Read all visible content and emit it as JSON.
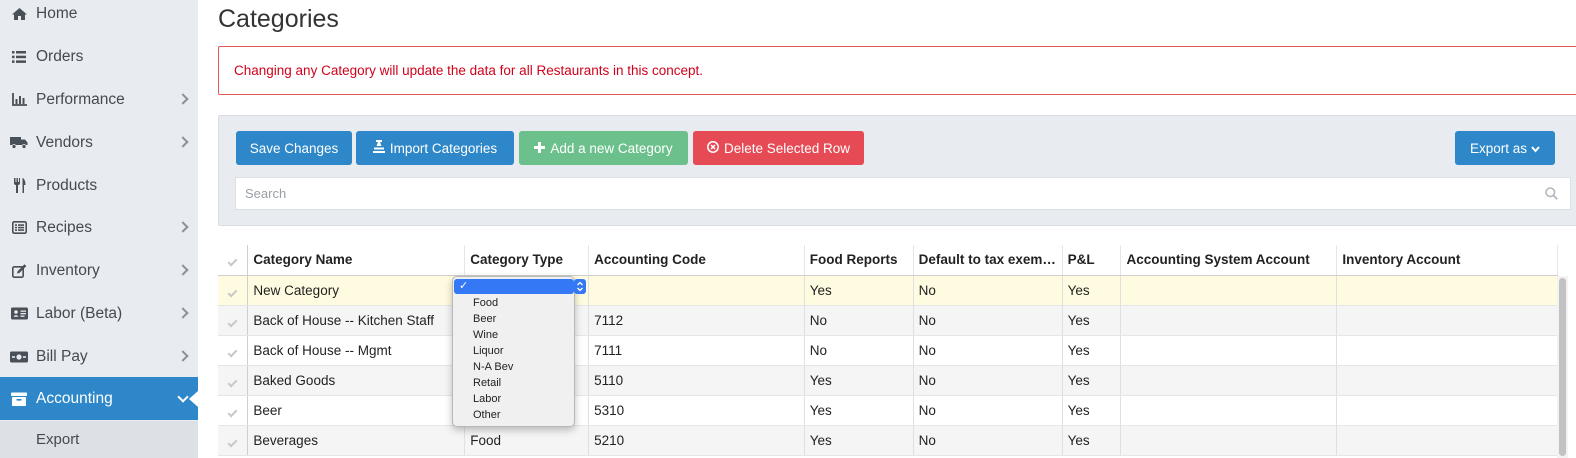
{
  "sidebar": {
    "items": [
      {
        "label": "Home",
        "icon": "home-icon",
        "has_chevron": false
      },
      {
        "label": "Orders",
        "icon": "list-icon",
        "has_chevron": false
      },
      {
        "label": "Performance",
        "icon": "bar-chart-icon",
        "has_chevron": true
      },
      {
        "label": "Vendors",
        "icon": "truck-icon",
        "has_chevron": true
      },
      {
        "label": "Products",
        "icon": "utensils-icon",
        "has_chevron": false
      },
      {
        "label": "Recipes",
        "icon": "list-alt-icon",
        "has_chevron": true
      },
      {
        "label": "Inventory",
        "icon": "edit-icon",
        "has_chevron": true
      },
      {
        "label": "Labor (Beta)",
        "icon": "id-card-icon",
        "has_chevron": true
      },
      {
        "label": "Bill Pay",
        "icon": "money-icon",
        "has_chevron": true
      },
      {
        "label": "Accounting",
        "icon": "archive-icon",
        "has_chevron": true,
        "active": true
      }
    ],
    "sub_item": "Export"
  },
  "page": {
    "title": "Categories",
    "alert": "Changing any Category will update the data for all Restaurants in this concept."
  },
  "toolbar": {
    "save_label": "Save Changes",
    "import_label": "Import Categories",
    "add_label": "Add a new Category",
    "delete_label": "Delete Selected Row",
    "export_label": "Export as",
    "search_placeholder": "Search"
  },
  "table": {
    "columns": [
      "Category Name",
      "Category Type",
      "Accounting Code",
      "Food Reports",
      "Default to tax exem…",
      "P&L",
      "Accounting System Account",
      "Inventory Account"
    ],
    "rows": [
      {
        "name": "New Category",
        "type": "",
        "code": "",
        "food_reports": "Yes",
        "tax_exempt": "No",
        "pl": "Yes",
        "acct_system": "",
        "inventory": ""
      },
      {
        "name": "Back of House -- Kitchen Staff",
        "type": "",
        "code": "7112",
        "food_reports": "No",
        "tax_exempt": "No",
        "pl": "Yes",
        "acct_system": "",
        "inventory": ""
      },
      {
        "name": "Back of House -- Mgmt",
        "type": "",
        "code": "7111",
        "food_reports": "No",
        "tax_exempt": "No",
        "pl": "Yes",
        "acct_system": "",
        "inventory": ""
      },
      {
        "name": "Baked Goods",
        "type": "",
        "code": "5110",
        "food_reports": "Yes",
        "tax_exempt": "No",
        "pl": "Yes",
        "acct_system": "",
        "inventory": ""
      },
      {
        "name": "Beer",
        "type": "",
        "code": "5310",
        "food_reports": "Yes",
        "tax_exempt": "No",
        "pl": "Yes",
        "acct_system": "",
        "inventory": ""
      },
      {
        "name": "Beverages",
        "type": "Food",
        "code": "5210",
        "food_reports": "Yes",
        "tax_exempt": "No",
        "pl": "Yes",
        "acct_system": "",
        "inventory": ""
      }
    ]
  },
  "dropdown": {
    "selected_mark": "✓",
    "options": [
      "Food",
      "Beer",
      "Wine",
      "Liquor",
      "N-A Bev",
      "Retail",
      "Labor",
      "Other"
    ]
  },
  "colors": {
    "primary": "#2d87c8",
    "success": "#6cc08b",
    "danger": "#e64a55",
    "alert_text": "#d0021b",
    "new_row": "#fffbe0"
  }
}
